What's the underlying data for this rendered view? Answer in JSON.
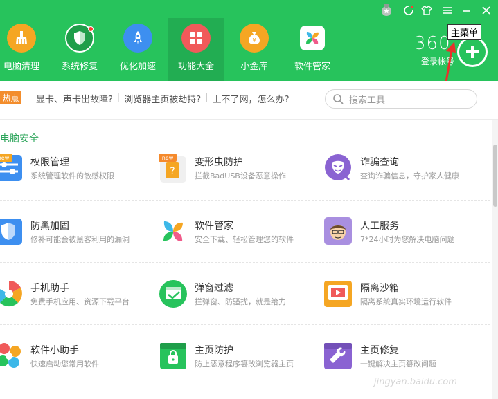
{
  "window": {
    "controls": [
      "skin-icon",
      "shirt-icon",
      "menu-lines-icon",
      "minimize-icon",
      "close-icon"
    ]
  },
  "nav": {
    "items": [
      {
        "label": "电脑清理",
        "icon": "broom-icon",
        "color": "#f5a623"
      },
      {
        "label": "系统修复",
        "icon": "shield-icon",
        "color": "#1f9e4a"
      },
      {
        "label": "优化加速",
        "icon": "rocket-icon",
        "color": "#3d8ff0"
      },
      {
        "label": "功能大全",
        "icon": "grid-icon",
        "color": "#f05a5a"
      },
      {
        "label": "小金库",
        "icon": "money-bag-icon",
        "color": "#f5a623"
      },
      {
        "label": "软件管家",
        "icon": "software-icon",
        "color": "#3db8e8"
      }
    ]
  },
  "account": {
    "brand": "360",
    "login": "登录帐号",
    "tooltip": "主菜单"
  },
  "hotbar": {
    "badge": "热点",
    "links": [
      "显卡、声卡出故障?",
      "浏览器主页被劫持?",
      "上不了网，怎么办?"
    ],
    "search_placeholder": "搜索工具"
  },
  "section": {
    "title": "电脑安全"
  },
  "tools": [
    {
      "name": "权限管理",
      "desc": "系统管理软件的敏感权限",
      "icon": "permission-icon",
      "badge": "new"
    },
    {
      "name": "变形虫防护",
      "desc": "拦截BadUSB设备恶意操作",
      "icon": "amoeba-icon",
      "badge": "new"
    },
    {
      "name": "诈骗查询",
      "desc": "查询诈骗信息，守护家人健康",
      "icon": "mask-icon"
    },
    {
      "name": "防黑加固",
      "desc": "修补可能会被黑客利用的漏洞",
      "icon": "shield-harden-icon"
    },
    {
      "name": "软件管家",
      "desc": "安全下载、轻松管理您的软件",
      "icon": "software-manager-icon"
    },
    {
      "name": "人工服务",
      "desc": "7*24小时为您解决电脑问题",
      "icon": "person-service-icon"
    },
    {
      "name": "手机助手",
      "desc": "免费手机应用、资源下载平台",
      "icon": "phone-assistant-icon"
    },
    {
      "name": "弹窗过滤",
      "desc": "拦弹窗、防骚扰，就是给力",
      "icon": "popup-filter-icon"
    },
    {
      "name": "隔离沙箱",
      "desc": "隔离系统真实环境运行软件",
      "icon": "sandbox-icon"
    },
    {
      "name": "软件小助手",
      "desc": "快速启动您常用软件",
      "icon": "software-helper-icon"
    },
    {
      "name": "主页防护",
      "desc": "防止恶意程序篡改浏览器主页",
      "icon": "homepage-lock-icon"
    },
    {
      "name": "主页修复",
      "desc": "一键解决主页篡改问题",
      "icon": "wrench-icon"
    }
  ],
  "watermark": "jingyan.baidu.com"
}
